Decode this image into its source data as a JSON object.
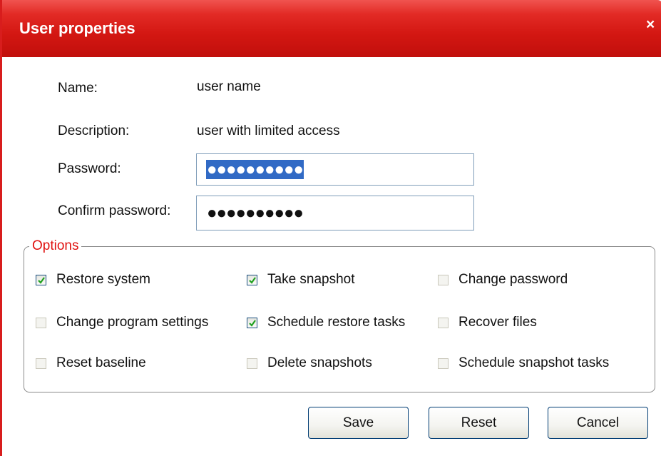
{
  "window": {
    "title": "User properties",
    "close_glyph": "×"
  },
  "fields": {
    "name_label": "Name:",
    "name_value": "user name",
    "description_label": "Description:",
    "description_value": "user with limited access",
    "password_label": "Password:",
    "password_value": "●●●●●●●●●●",
    "confirm_label": "Confirm password:",
    "confirm_value": "●●●●●●●●●●"
  },
  "options": {
    "legend": "Options",
    "items": [
      {
        "label": "Restore system",
        "checked": true,
        "enabled": true
      },
      {
        "label": "Take snapshot",
        "checked": true,
        "enabled": true
      },
      {
        "label": "Change password",
        "checked": false,
        "enabled": false
      },
      {
        "label": "Change program settings",
        "checked": false,
        "enabled": false
      },
      {
        "label": "Schedule restore tasks",
        "checked": true,
        "enabled": true
      },
      {
        "label": "Recover files",
        "checked": false,
        "enabled": false
      },
      {
        "label": "Reset baseline",
        "checked": false,
        "enabled": false
      },
      {
        "label": "Delete snapshots",
        "checked": false,
        "enabled": false
      },
      {
        "label": "Schedule snapshot tasks",
        "checked": false,
        "enabled": false
      }
    ]
  },
  "buttons": {
    "save": "Save",
    "reset": "Reset",
    "cancel": "Cancel"
  },
  "colors": {
    "titlebar": "#d31712",
    "legend": "#e0110f",
    "selection": "#316ac5",
    "check": "#21a121"
  }
}
